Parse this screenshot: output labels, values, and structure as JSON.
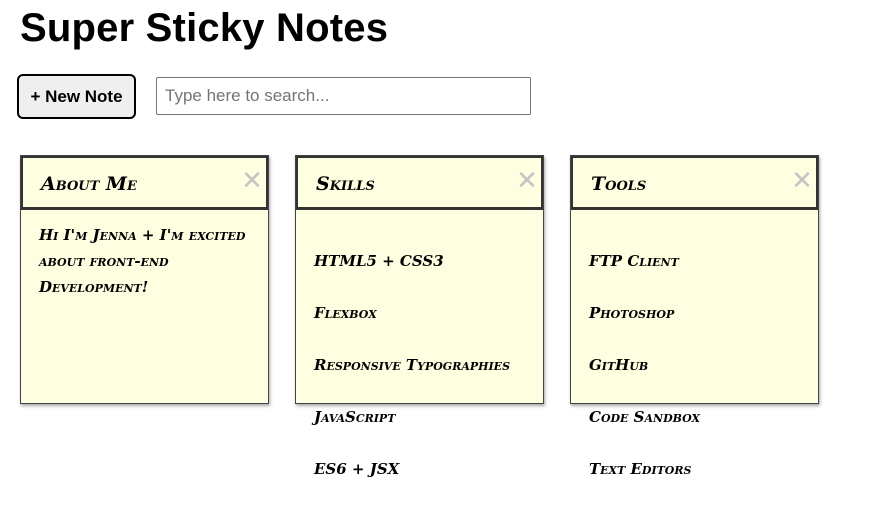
{
  "header": {
    "title": "Super Sticky Notes"
  },
  "toolbar": {
    "new_note_label": "+ New Note",
    "search_placeholder": "Type here to search...",
    "search_value": ""
  },
  "notes": [
    {
      "title": "About Me",
      "delete_label": "✕",
      "description": "Hi I'm Jenna + I'm excited about front-end Development!"
    },
    {
      "title": "Skills",
      "delete_label": "✕",
      "items": [
        "HTML5 + CSS3",
        "Flexbox",
        "Responsive Typographies",
        "JavaScript",
        "ES6 + JSX"
      ]
    },
    {
      "title": "Tools",
      "delete_label": "✕",
      "items": [
        "FTP Client",
        "Photoshop",
        "GitHub",
        "Code Sandbox",
        "Text Editors"
      ]
    }
  ],
  "colors": {
    "note_background": "#fefee0",
    "note_border": "#333333",
    "delete_icon": "#c4c4c4",
    "button_background": "#efefef"
  },
  "icons": {
    "delete": "close-icon"
  }
}
